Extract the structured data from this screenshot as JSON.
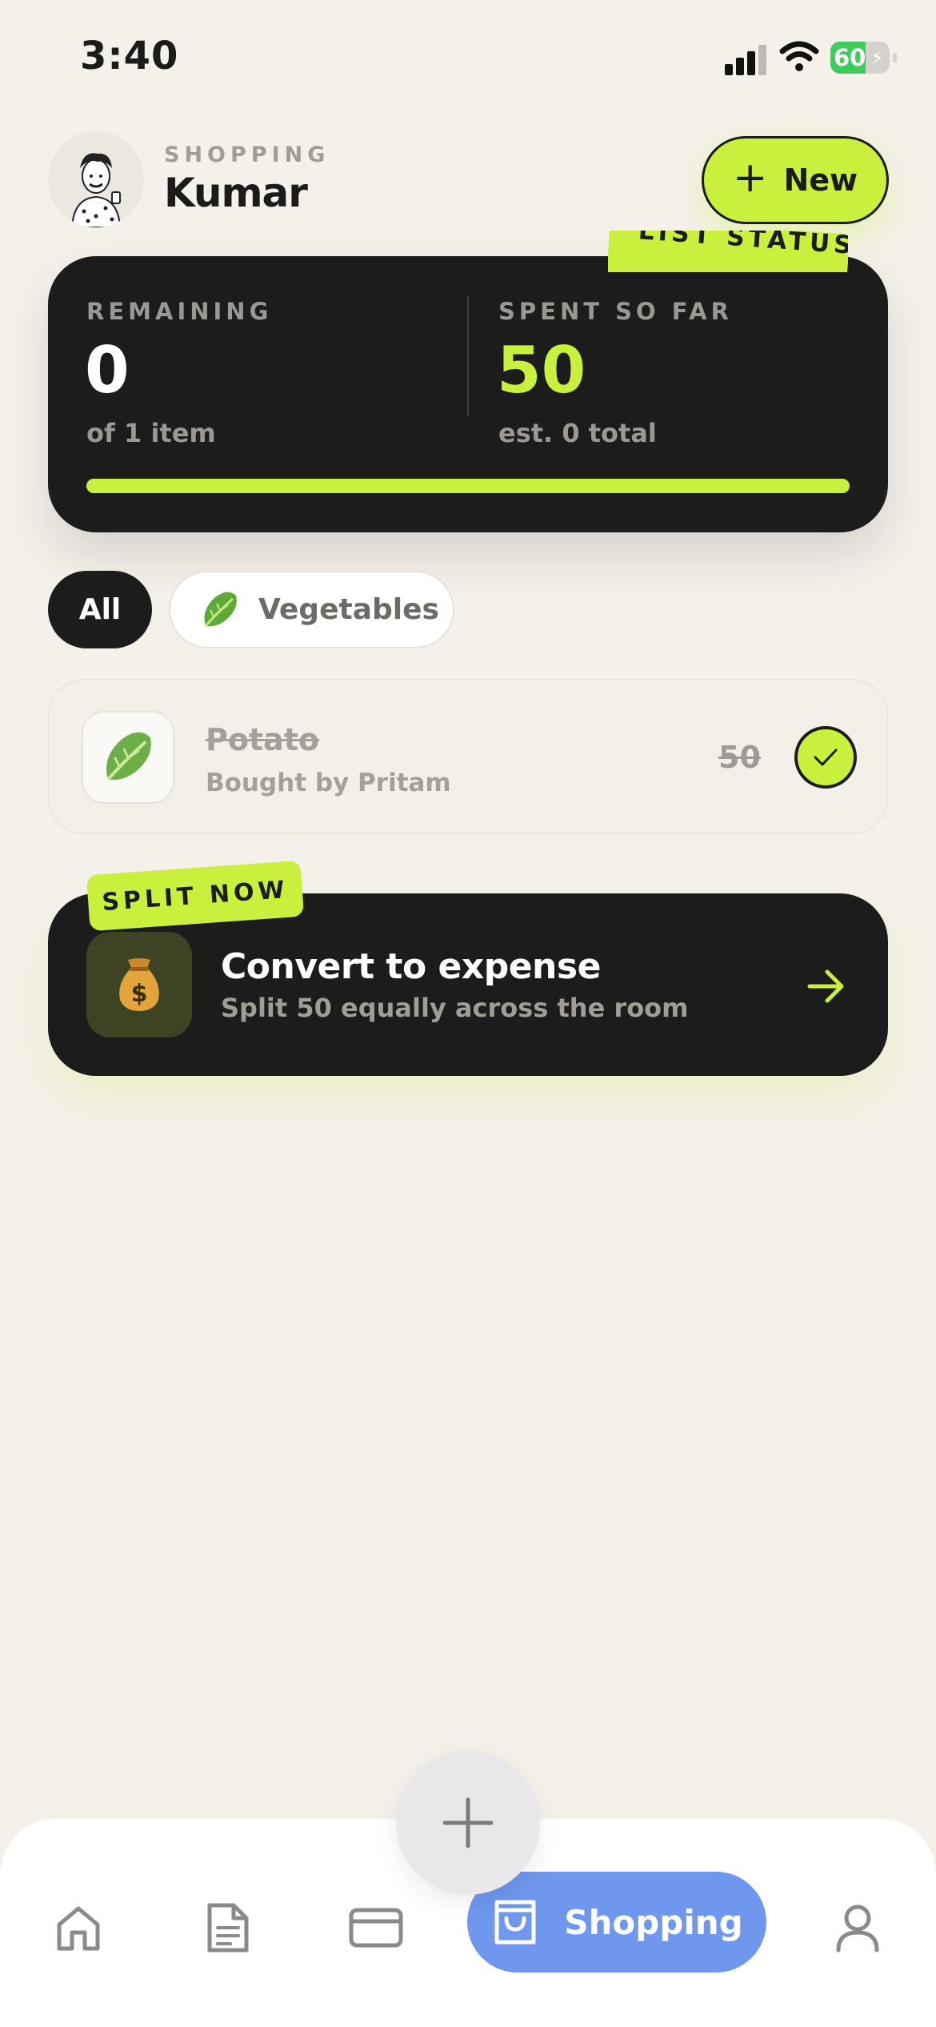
{
  "status_bar": {
    "time": "3:40",
    "battery": "60"
  },
  "header": {
    "eyebrow": "SHOPPING",
    "title": "Kumar",
    "new_label": "New"
  },
  "status_card": {
    "tag": "LIST STATUS",
    "remaining_label": "REMAINING",
    "remaining_value": "0",
    "remaining_sub": "of 1 item",
    "spent_label": "SPENT SO FAR",
    "spent_value": "50",
    "spent_sub": "est. 0 total",
    "progress": 1.0
  },
  "filters": [
    {
      "label": "All",
      "active": true
    },
    {
      "label": "Vegetables",
      "icon": "lettuce-icon",
      "active": false
    }
  ],
  "items": [
    {
      "name": "Potato",
      "subtitle": "Bought by Pritam",
      "price": "50",
      "checked": true,
      "icon": "lettuce-icon"
    }
  ],
  "convert_card": {
    "tag": "SPLIT NOW",
    "title": "Convert to expense",
    "subtitle": "Split 50 equally across the room",
    "icon": "money-bag-icon"
  },
  "nav": {
    "items": [
      {
        "name": "home",
        "icon": "home-icon"
      },
      {
        "name": "documents",
        "icon": "document-icon"
      },
      {
        "name": "cards",
        "icon": "card-icon"
      },
      {
        "name": "shopping",
        "icon": "shopping-bag-icon",
        "label": "Shopping",
        "active": true
      },
      {
        "name": "profile",
        "icon": "profile-icon"
      }
    ]
  },
  "colors": {
    "accent": "#c8f03c",
    "dark": "#1c1c1c",
    "nav_active": "#6f97ee",
    "background": "#f5f0ea"
  }
}
